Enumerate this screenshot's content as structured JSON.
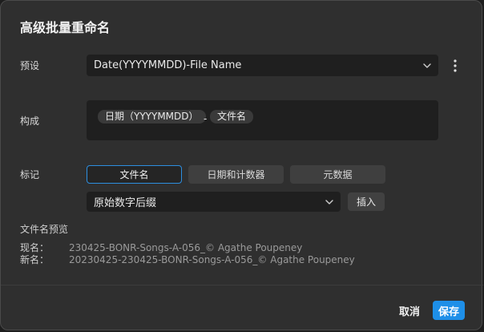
{
  "dialog": {
    "title": "高级批量重命名"
  },
  "preset": {
    "label": "预设",
    "value": "Date(YYYYMMDD)-File Name"
  },
  "composition": {
    "label": "构成",
    "tokens": [
      {
        "text": "日期（YYYYMMDD）"
      },
      {
        "text": "文件名"
      }
    ],
    "separator": "-"
  },
  "tags": {
    "label": "标记",
    "tabs": [
      {
        "label": "文件名",
        "active": true
      },
      {
        "label": "日期和计数器",
        "active": false
      },
      {
        "label": "元数据",
        "active": false
      }
    ],
    "dropdown_value": "原始数字后缀",
    "insert_label": "插入"
  },
  "preview": {
    "heading": "文件名预览",
    "current_label": "现名：",
    "current_value": "230425-BONR-Songs-A-056_© Agathe Poupeney",
    "new_label": "新名：",
    "new_value": "20230425-230425-BONR-Songs-A-056_© Agathe Poupeney"
  },
  "footer": {
    "cancel_label": "取消",
    "save_label": "保存"
  },
  "colors": {
    "accent": "#1e8fe8",
    "background": "#2f2f2f",
    "field": "#1f1f1f"
  },
  "icons": [
    "chevron-down-icon",
    "more-vertical-icon"
  ]
}
